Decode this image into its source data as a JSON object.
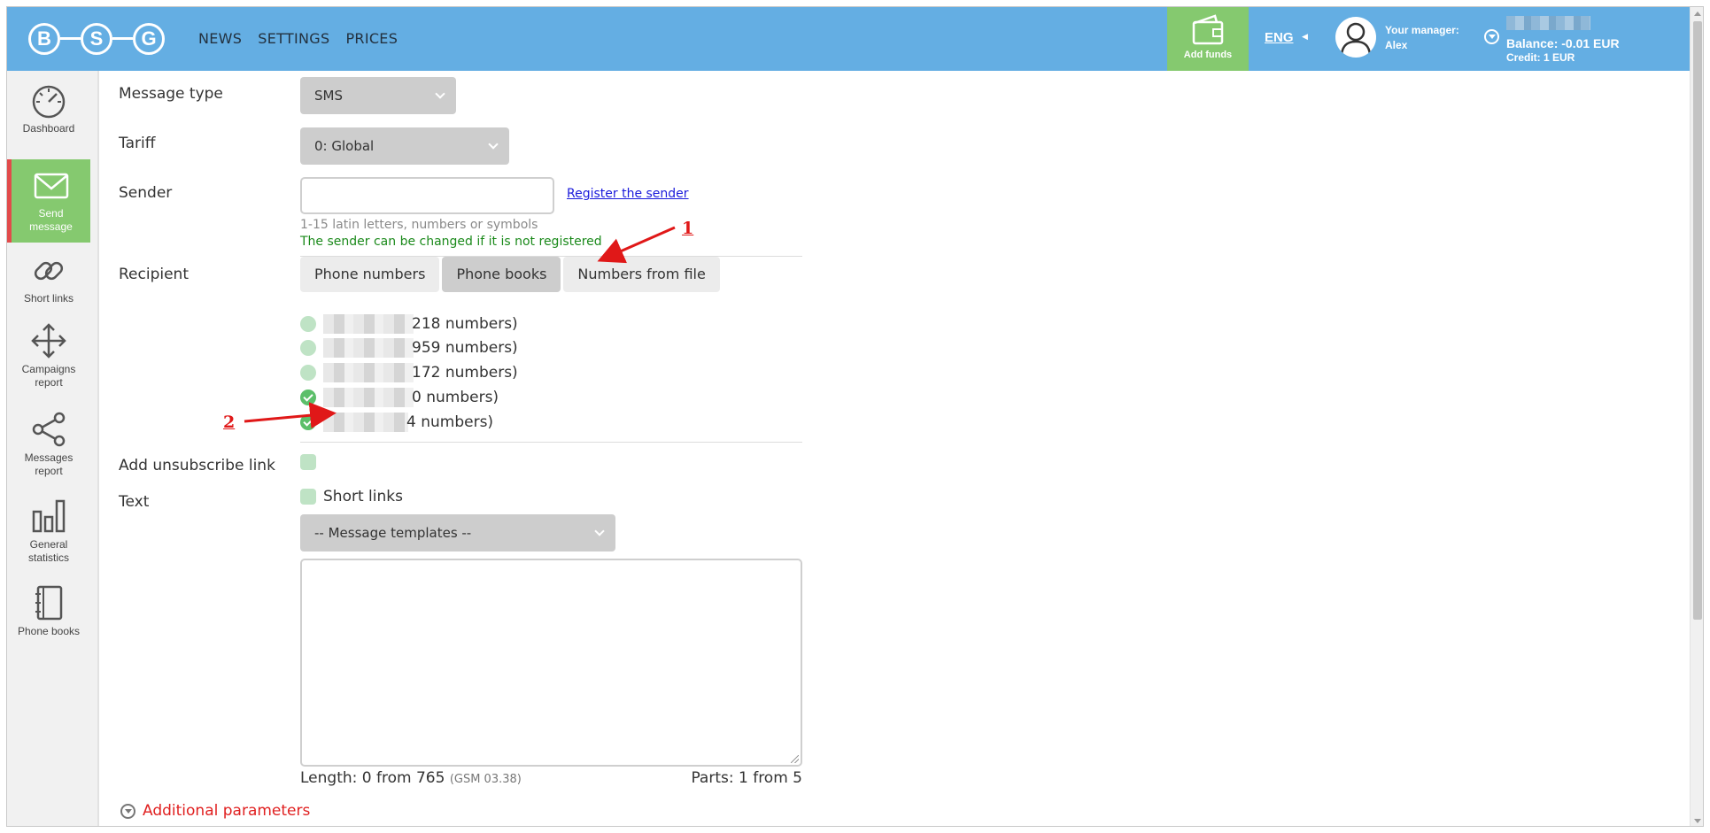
{
  "header": {
    "logo_letters": [
      "B",
      "S",
      "G"
    ],
    "nav": [
      "NEWS",
      "SETTINGS",
      "PRICES"
    ],
    "add_funds": "Add funds",
    "language": "ENG",
    "manager_label": "Your manager:",
    "manager_name": "Alex",
    "balance": "Balance: -0.01 EUR",
    "credit": "Credit: 1 EUR",
    "accent_color": "#64aee3",
    "add_funds_color": "#85c96f"
  },
  "sidebar": {
    "items": [
      {
        "label_lines": [
          "Dashboard"
        ],
        "icon": "speedometer-icon"
      },
      {
        "label_lines": [
          "Send",
          "message"
        ],
        "icon": "envelope-icon",
        "active": true
      },
      {
        "label_lines": [
          "Short links"
        ],
        "icon": "link-icon"
      },
      {
        "label_lines": [
          "Campaigns",
          "report"
        ],
        "icon": "move-arrows-icon"
      },
      {
        "label_lines": [
          "Messages",
          "report"
        ],
        "icon": "share-icon"
      },
      {
        "label_lines": [
          "General",
          "statistics"
        ],
        "icon": "bar-chart-icon"
      },
      {
        "label_lines": [
          "Phone books"
        ],
        "icon": "notebook-icon"
      }
    ]
  },
  "form": {
    "message_type_label": "Message type",
    "message_type_value": "SMS",
    "tariff_label": "Tariff",
    "tariff_value": "0: Global",
    "sender_label": "Sender",
    "sender_value": "",
    "register_link": "Register the sender",
    "sender_hint": "1-15 latin letters, numbers or symbols",
    "sender_note": "The sender can be changed if it is not registered",
    "recipient_label": "Recipient",
    "recipient_tabs": [
      {
        "label": "Phone numbers",
        "active": false
      },
      {
        "label": "Phone books",
        "active": true
      },
      {
        "label": "Numbers from file",
        "active": false
      }
    ],
    "phone_books": [
      {
        "count_text": "218 numbers)",
        "checked": false
      },
      {
        "count_text": "959 numbers)",
        "checked": false
      },
      {
        "count_text": "172 numbers)",
        "checked": false
      },
      {
        "count_text": "0 numbers)",
        "checked": true
      },
      {
        "count_text": "4 numbers)",
        "checked": true
      }
    ],
    "unsubscribe_label": "Add unsubscribe link",
    "text_label": "Text",
    "short_links_label": "Short links",
    "templates_placeholder": "-- Message templates --",
    "message_text": "",
    "length_text": "Length: 0 from 765",
    "length_encoding": "(GSM 03.38)",
    "parts_text": "Parts: 1 from 5",
    "additional_params": "Additional parameters"
  },
  "annotations": {
    "marker_1": "1",
    "marker_2": "2",
    "color": "#e01818"
  }
}
